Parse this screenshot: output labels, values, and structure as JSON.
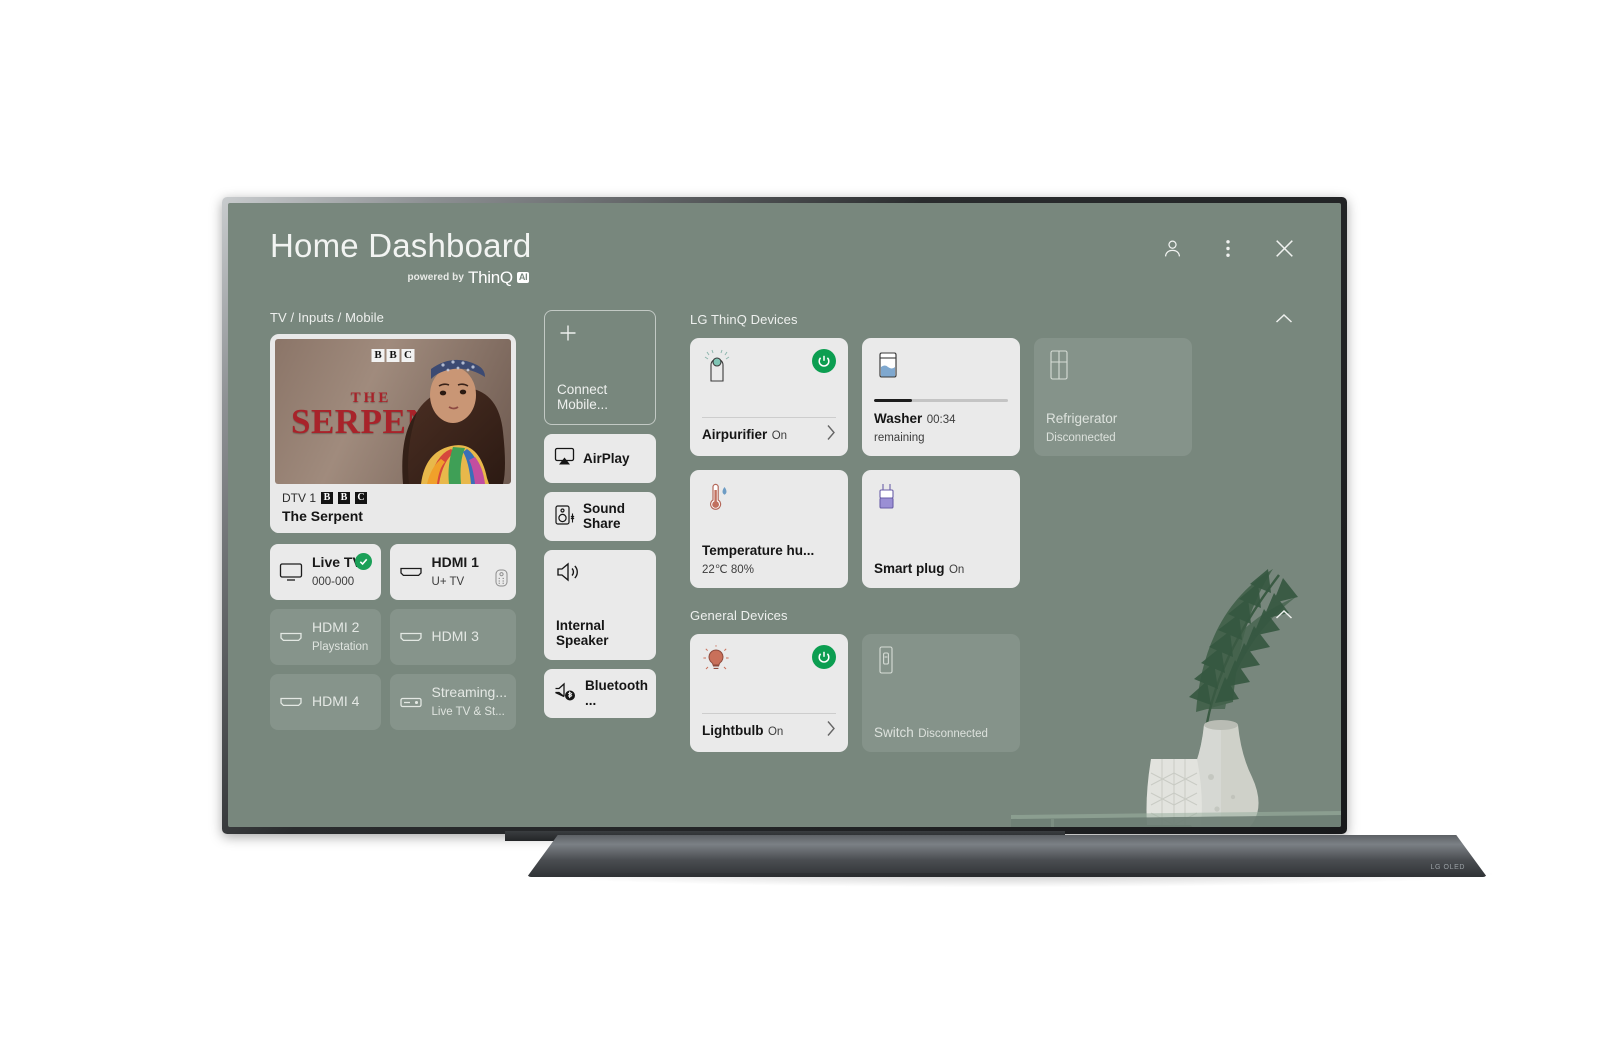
{
  "header": {
    "title": "Home Dashboard",
    "powered_by": "powered by",
    "thinq_word": "ThinQ",
    "ai_badge": "AI",
    "actions": [
      {
        "name": "profile-icon",
        "label": "Profile"
      },
      {
        "name": "more-options-icon",
        "label": "More options"
      },
      {
        "name": "close-icon",
        "label": "Close"
      }
    ]
  },
  "colors": {
    "screen_background": "#78877d",
    "card_background": "#eaeaea",
    "accent_green": "#0c9e51",
    "text_light": "#eef0ee",
    "text_dark": "#151515"
  },
  "left": {
    "section_title": "TV / Inputs / Mobile",
    "preview": {
      "channel": "DTV 1",
      "broadcaster": "BBC",
      "broadcaster_letters": [
        "B",
        "B",
        "C"
      ],
      "program": "The Serpent",
      "poster_the": "THE",
      "poster_title": "SERPENT"
    },
    "inputs": [
      {
        "name": "Live TV",
        "sub": "000-000",
        "icon": "tv-icon",
        "active": true,
        "badge": "check"
      },
      {
        "name": "HDMI 1",
        "sub": "U+ TV",
        "icon": "hdmi-icon",
        "active": true,
        "badge": "remote"
      },
      {
        "name": "HDMI 2",
        "sub": "Playstation",
        "icon": "hdmi-icon",
        "active": false,
        "badge": ""
      },
      {
        "name": "HDMI 3",
        "sub": "",
        "icon": "hdmi-icon",
        "active": false,
        "badge": ""
      },
      {
        "name": "HDMI 4",
        "sub": "",
        "icon": "hdmi-icon",
        "active": false,
        "badge": ""
      },
      {
        "name": "Streaming...",
        "sub": "Live TV & St...",
        "icon": "streaming-box-icon",
        "active": false,
        "badge": ""
      }
    ]
  },
  "middle": {
    "connect_mobile": {
      "label": "Connect Mobile...",
      "icon": "plus-icon"
    },
    "airplay": {
      "label": "AirPlay",
      "icon": "airplay-icon"
    },
    "sound_share": {
      "label": "Sound Share",
      "icon": "sound-share-icon"
    },
    "internal_speaker": {
      "label": "Internal Speaker",
      "icon": "speaker-icon"
    },
    "bluetooth": {
      "label": "Bluetooth ...",
      "icon": "bluetooth-speaker-icon"
    }
  },
  "right": {
    "thinq_section_title": "LG ThinQ Devices",
    "general_section_title": "General Devices",
    "thinq_devices": [
      {
        "name": "Airpurifier",
        "state": "On",
        "icon": "airpurifier-icon",
        "connected": true,
        "power": true,
        "chevron": true,
        "divider": true,
        "progress": null
      },
      {
        "name": "Washer",
        "state": "00:34 remaining",
        "icon": "washer-icon",
        "connected": true,
        "power": false,
        "chevron": false,
        "divider": false,
        "progress": 28
      },
      {
        "name": "Refrigerator",
        "state": "Disconnected",
        "icon": "refrigerator-icon",
        "connected": false,
        "power": false,
        "chevron": false,
        "divider": false,
        "progress": null
      },
      {
        "name": "Temperature hu...",
        "state": "22℃ 80%",
        "icon": "thermometer-icon",
        "connected": true,
        "power": false,
        "chevron": false,
        "divider": false,
        "progress": null
      },
      {
        "name": "Smart plug",
        "state": "On",
        "icon": "smart-plug-icon",
        "connected": true,
        "power": false,
        "chevron": false,
        "divider": false,
        "progress": null
      }
    ],
    "general_devices": [
      {
        "name": "Lightbulb",
        "state": "On",
        "icon": "lightbulb-icon",
        "connected": true,
        "power": true,
        "chevron": true,
        "divider": true
      },
      {
        "name": "Switch",
        "state": "Disconnected",
        "icon": "wall-switch-icon",
        "connected": false,
        "power": false,
        "chevron": false,
        "divider": false
      }
    ]
  },
  "tv": {
    "brand_mark": "LG OLED"
  }
}
